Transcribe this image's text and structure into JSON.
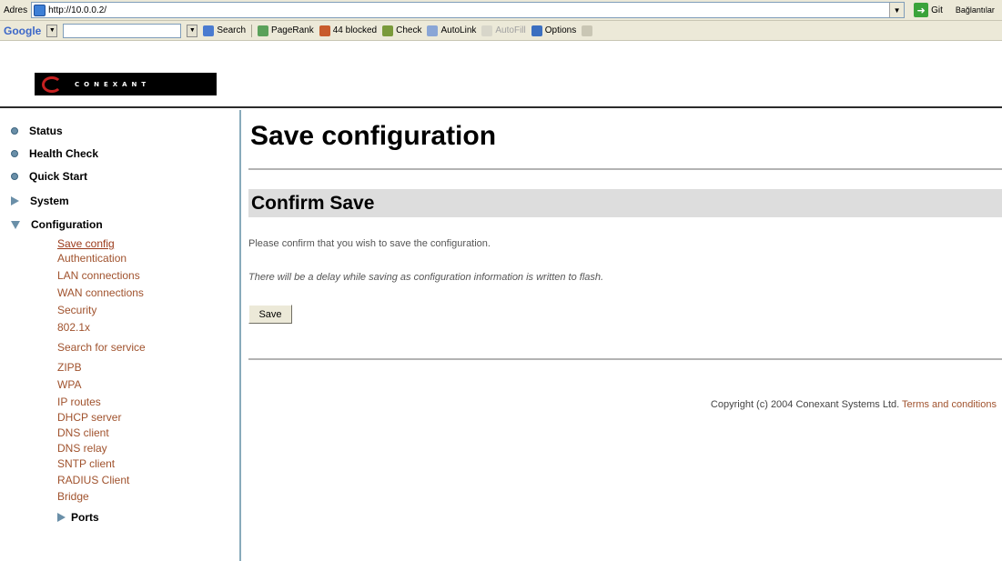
{
  "browser": {
    "address_label": "Adres",
    "url": "http://10.0.0.2/",
    "go_label": "Git",
    "links_label": "Bağlantılar"
  },
  "google_toolbar": {
    "logo": "Google",
    "search_label": "Search",
    "pagerank_label": "PageRank",
    "blocked_label": "44 blocked",
    "check_label": "Check",
    "autolink_label": "AutoLink",
    "autofill_label": "AutoFill",
    "options_label": "Options"
  },
  "logo_text": "CONEXANT",
  "nav": {
    "status": "Status",
    "health_check": "Health Check",
    "quick_start": "Quick Start",
    "system": "System",
    "configuration": "Configuration",
    "sub_items": [
      "Save config",
      "Authentication",
      "LAN connections",
      "WAN connections",
      "Security",
      "802.1x",
      "Search for service",
      "ZIPB",
      "WPA",
      "IP routes",
      "DHCP server",
      "DNS client",
      "DNS relay",
      "SNTP client",
      "RADIUS Client",
      "Bridge"
    ],
    "ports": "Ports"
  },
  "main": {
    "page_title": "Save configuration",
    "section_title": "Confirm Save",
    "confirm_text": "Please confirm that you wish to save the configuration.",
    "delay_text": "There will be a delay while saving as configuration information is written to flash.",
    "save_button": "Save",
    "copyright": "Copyright (c) 2004 Conexant Systems Ltd.",
    "terms_link": "Terms and conditions"
  },
  "colors": {
    "link": "#a0522d",
    "section_bar": "#dddddd",
    "sidebar_border": "#88aabb"
  }
}
